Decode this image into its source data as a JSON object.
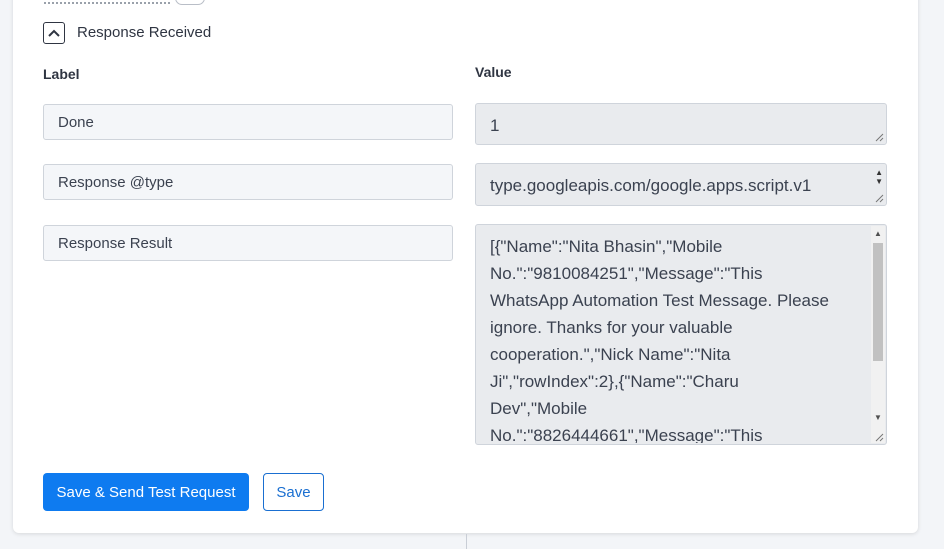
{
  "section": {
    "title": "Response Received"
  },
  "columns": {
    "label": "Label",
    "value": "Value"
  },
  "rows": [
    {
      "label": "Done",
      "value": "1"
    },
    {
      "label": "Response @type",
      "value": "type.googleapis.com/google.apps.script.v1"
    },
    {
      "label": "Response Result",
      "value": "[{\"Name\":\"Nita Bhasin\",\"Mobile No.\":\"9810084251\",\"Message\":\"This WhatsApp Automation Test Message. Please ignore. Thanks for your valuable cooperation.\",\"Nick Name\":\"Nita Ji\",\"rowIndex\":2},{\"Name\":\"Charu Dev\",\"Mobile No.\":\"8826444661\",\"Message\":\"This"
    }
  ],
  "buttons": {
    "primary": "Save & Send Test Request",
    "secondary": "Save"
  },
  "colors": {
    "accent": "#0e7bf0",
    "field_bg": "#e9ebee",
    "label_bg": "#f4f6f9"
  }
}
